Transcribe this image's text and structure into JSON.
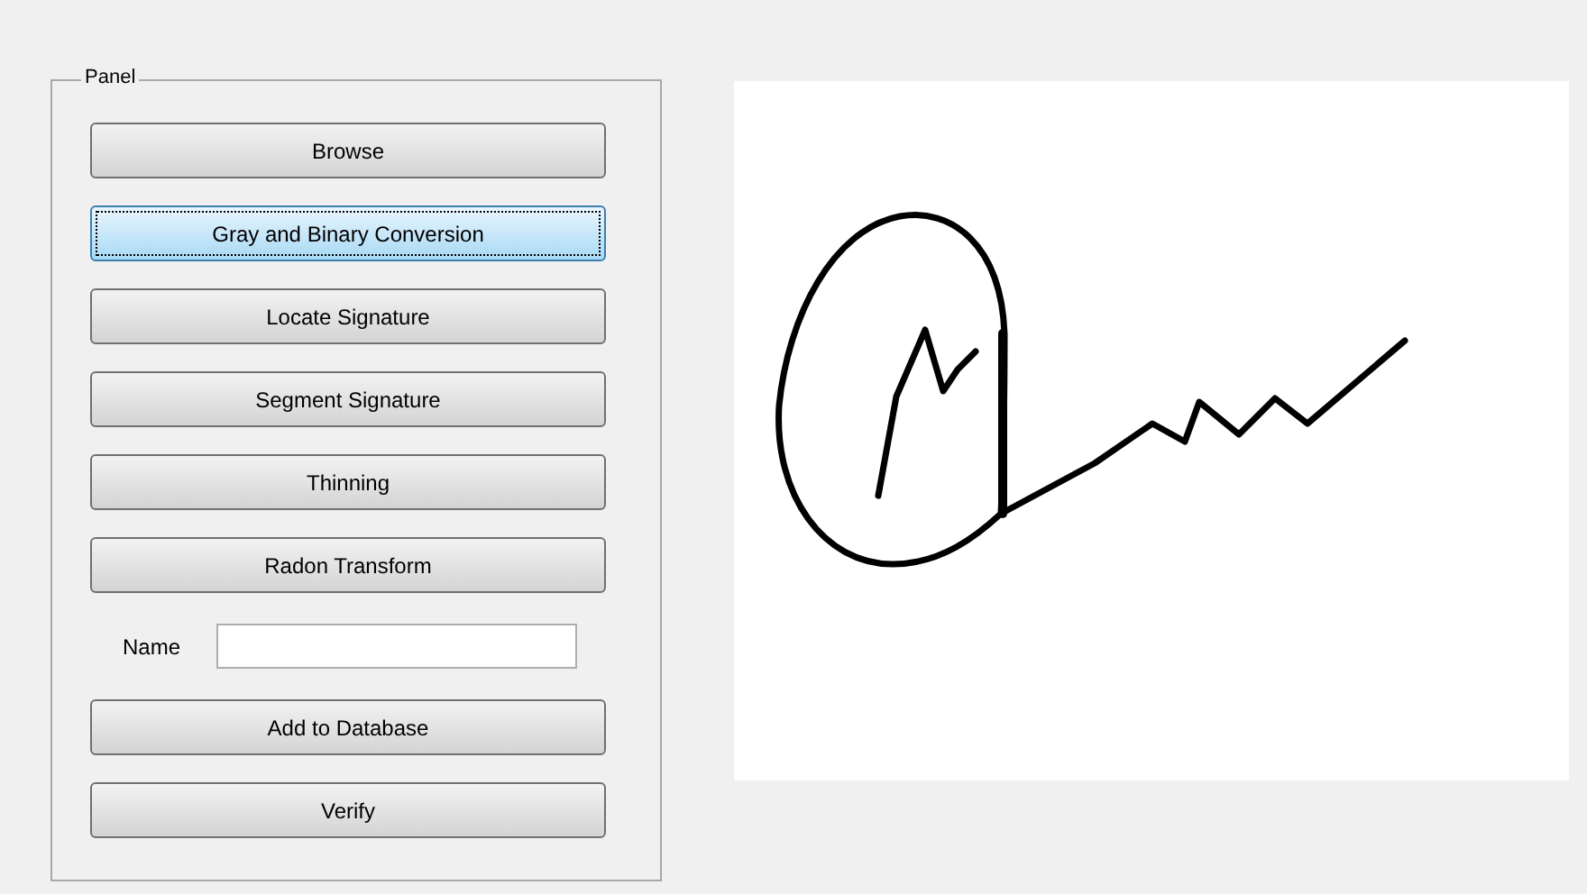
{
  "panel": {
    "title": "Panel",
    "items": [
      {
        "kind": "button",
        "label": "Browse",
        "focused": false
      },
      {
        "kind": "button",
        "label": "Gray and Binary Conversion",
        "focused": true
      },
      {
        "kind": "button",
        "label": "Locate Signature",
        "focused": false
      },
      {
        "kind": "button",
        "label": "Segment Signature",
        "focused": false
      },
      {
        "kind": "button",
        "label": "Thinning",
        "focused": false
      },
      {
        "kind": "button",
        "label": "Radon Transform",
        "focused": false
      },
      {
        "kind": "field",
        "label": "Name"
      },
      {
        "kind": "button",
        "label": "Add to Database",
        "focused": false
      },
      {
        "kind": "button",
        "label": "Verify",
        "focused": false
      }
    ]
  }
}
